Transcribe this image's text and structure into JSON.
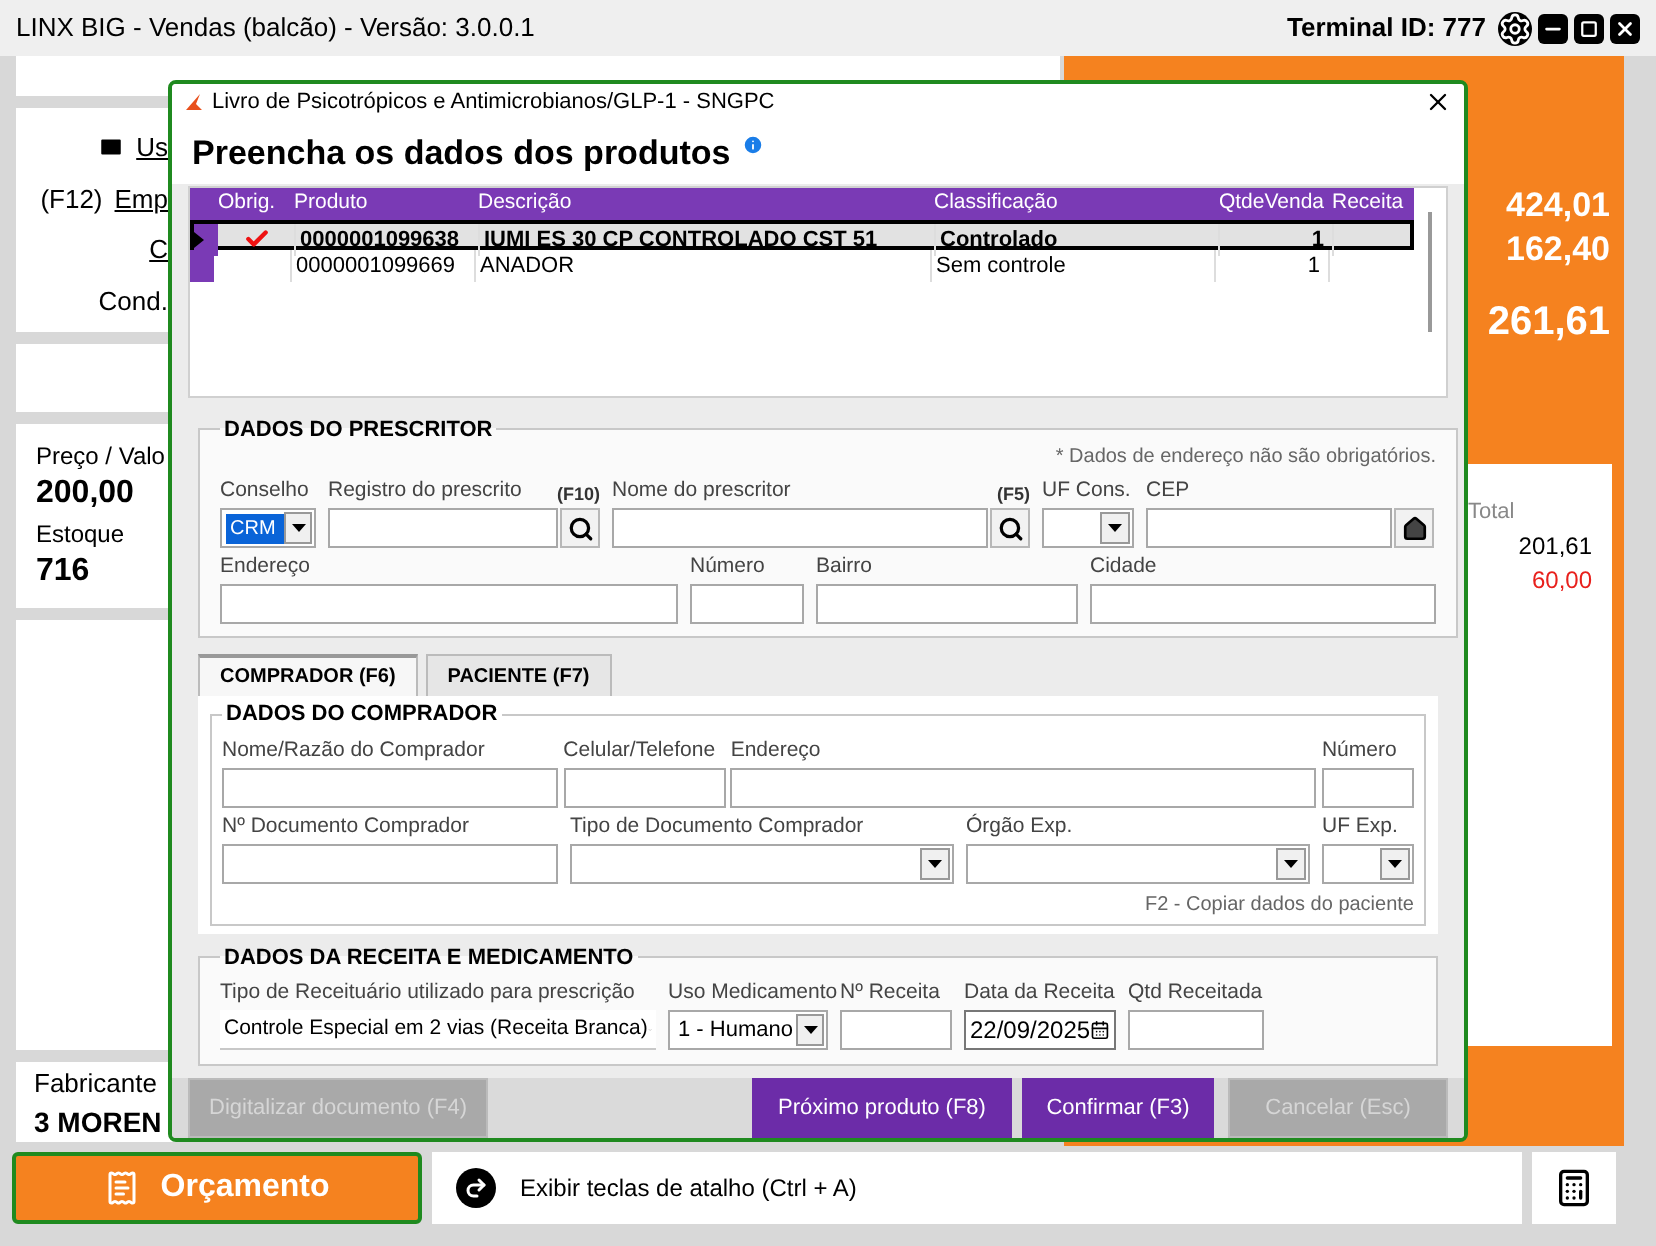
{
  "app": {
    "title": "LINX BIG - Vendas (balcão) - Versão: 3.0.0.1",
    "terminal": "Terminal ID: 777"
  },
  "customer_lines": [
    {
      "kind": "mail",
      "text": "Us"
    },
    {
      "kind": "shortcut",
      "prefix": "(F12)",
      "text": "Emp"
    },
    {
      "kind": "link",
      "text": "C"
    },
    {
      "kind": "plain",
      "text": "Cond."
    }
  ],
  "product_info": [
    {
      "label": "Preço / Valo",
      "value": "200,00"
    },
    {
      "label": "Estoque",
      "value": "716"
    }
  ],
  "manufacturer": {
    "label": "Fabricante",
    "value": "3 MOREN"
  },
  "totals": [
    "424,01",
    "162,40",
    "261,61"
  ],
  "summary": {
    "label": "Total",
    "values": [
      {
        "text": "201,61",
        "color": "#000000"
      },
      {
        "text": "60,00",
        "color": "#e8201c"
      }
    ]
  },
  "footer": {
    "button": "Orçamento",
    "shortcut": "Exibir teclas de atalho (Ctrl + A)"
  },
  "dialog": {
    "title": "Livro de Psicotrópicos e Antimicrobianos/GLP-1 - SNGPC",
    "heading": "Preencha os dados dos produtos",
    "table": {
      "columns": [
        "Obrig.",
        "Produto",
        "Descrição",
        "Classificação",
        "QtdeVenda",
        "Receita"
      ],
      "rows": [
        {
          "selected": true,
          "required": true,
          "produto": "0000001099638",
          "descricao": "IUMI ES 30 CP CONTROLADO CST 51",
          "classificacao": "Controlado",
          "qtde": "1"
        },
        {
          "selected": false,
          "required": false,
          "produto": "0000001099669",
          "descricao": "ANADOR",
          "classificacao": "Sem controle",
          "qtde": "1"
        }
      ]
    },
    "prescriber": {
      "title": "DADOS DO PRESCRITOR",
      "note": "* Dados de endereço não são obrigatórios.",
      "rows": [
        {
          "fields": [
            {
              "kind": "select",
              "label": "Conselho",
              "value": "CRM",
              "highlighted": true
            },
            {
              "kind": "search",
              "label": "Registro do prescrito",
              "hint": "(F10)"
            },
            {
              "kind": "search",
              "label": "Nome do prescritor",
              "hint": "(F5)"
            },
            {
              "kind": "select",
              "label": "UF Cons."
            },
            {
              "kind": "cep",
              "label": "CEP"
            }
          ]
        },
        {
          "fields": [
            {
              "kind": "text",
              "label": "Endereço"
            },
            {
              "kind": "text",
              "label": "Número"
            },
            {
              "kind": "text",
              "label": "Bairro"
            },
            {
              "kind": "text",
              "label": "Cidade"
            }
          ]
        }
      ]
    },
    "tabs": [
      {
        "label": "COMPRADOR (F6)",
        "selected": true
      },
      {
        "label": "PACIENTE (F7)",
        "selected": false
      }
    ],
    "buyer": {
      "title": "DADOS DO COMPRADOR",
      "note": "F2 - Copiar dados do paciente",
      "rows": [
        {
          "fields": [
            {
              "kind": "text",
              "label": "Nome/Razão do Comprador"
            },
            {
              "kind": "text",
              "label": "Celular/Telefone"
            },
            {
              "kind": "text",
              "label": "Endereço"
            },
            {
              "kind": "text",
              "label": "Número"
            }
          ]
        },
        {
          "fields": [
            {
              "kind": "text",
              "label": "Nº Documento Comprador"
            },
            {
              "kind": "select",
              "label": "Tipo de Documento Comprador"
            },
            {
              "kind": "select",
              "label": "Órgão Exp."
            },
            {
              "kind": "select",
              "label": "UF Exp."
            }
          ]
        }
      ]
    },
    "prescription": {
      "title": "DADOS DA RECEITA E MEDICAMENTO",
      "rows": [
        {
          "fields": [
            {
              "kind": "combo",
              "label": "Tipo de Receituário utilizado para prescrição",
              "value": "Controle Especial em 2 vias (Receita Branca)"
            },
            {
              "kind": "select",
              "label": "Uso Medicamento",
              "value": "1 - Humano"
            },
            {
              "kind": "text",
              "label": "Nº Receita"
            },
            {
              "kind": "date",
              "label": "Data da Receita",
              "value": "22/09/2025"
            },
            {
              "kind": "text",
              "label": "Qtd Receitada"
            }
          ]
        }
      ]
    },
    "buttons": [
      {
        "label": "Digitalizar documento (F4)",
        "disabled": true
      },
      {
        "label": "Próximo produto (F8)",
        "disabled": false
      },
      {
        "label": "Confirmar (F3)",
        "disabled": false
      },
      {
        "label": "Cancelar (Esc)",
        "disabled": true
      }
    ]
  }
}
